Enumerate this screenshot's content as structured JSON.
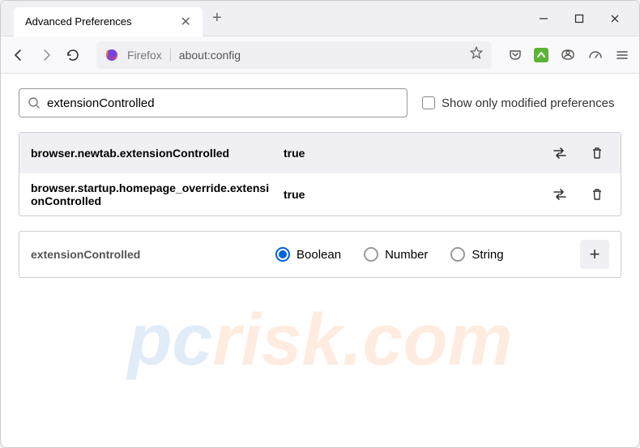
{
  "tab": {
    "title": "Advanced Preferences"
  },
  "addressbar": {
    "protocol": "Firefox",
    "url": "about:config"
  },
  "search": {
    "value": "extensionControlled"
  },
  "modified_checkbox": {
    "label": "Show only modified preferences"
  },
  "prefs": [
    {
      "name": "browser.newtab.extensionControlled",
      "value": "true"
    },
    {
      "name": "browser.startup.homepage_override.extensionControlled",
      "value": "true"
    }
  ],
  "newpref": {
    "name": "extensionControlled",
    "types": [
      "Boolean",
      "Number",
      "String"
    ]
  },
  "watermark": {
    "prefix": "pc",
    "suffix": "risk.com"
  }
}
